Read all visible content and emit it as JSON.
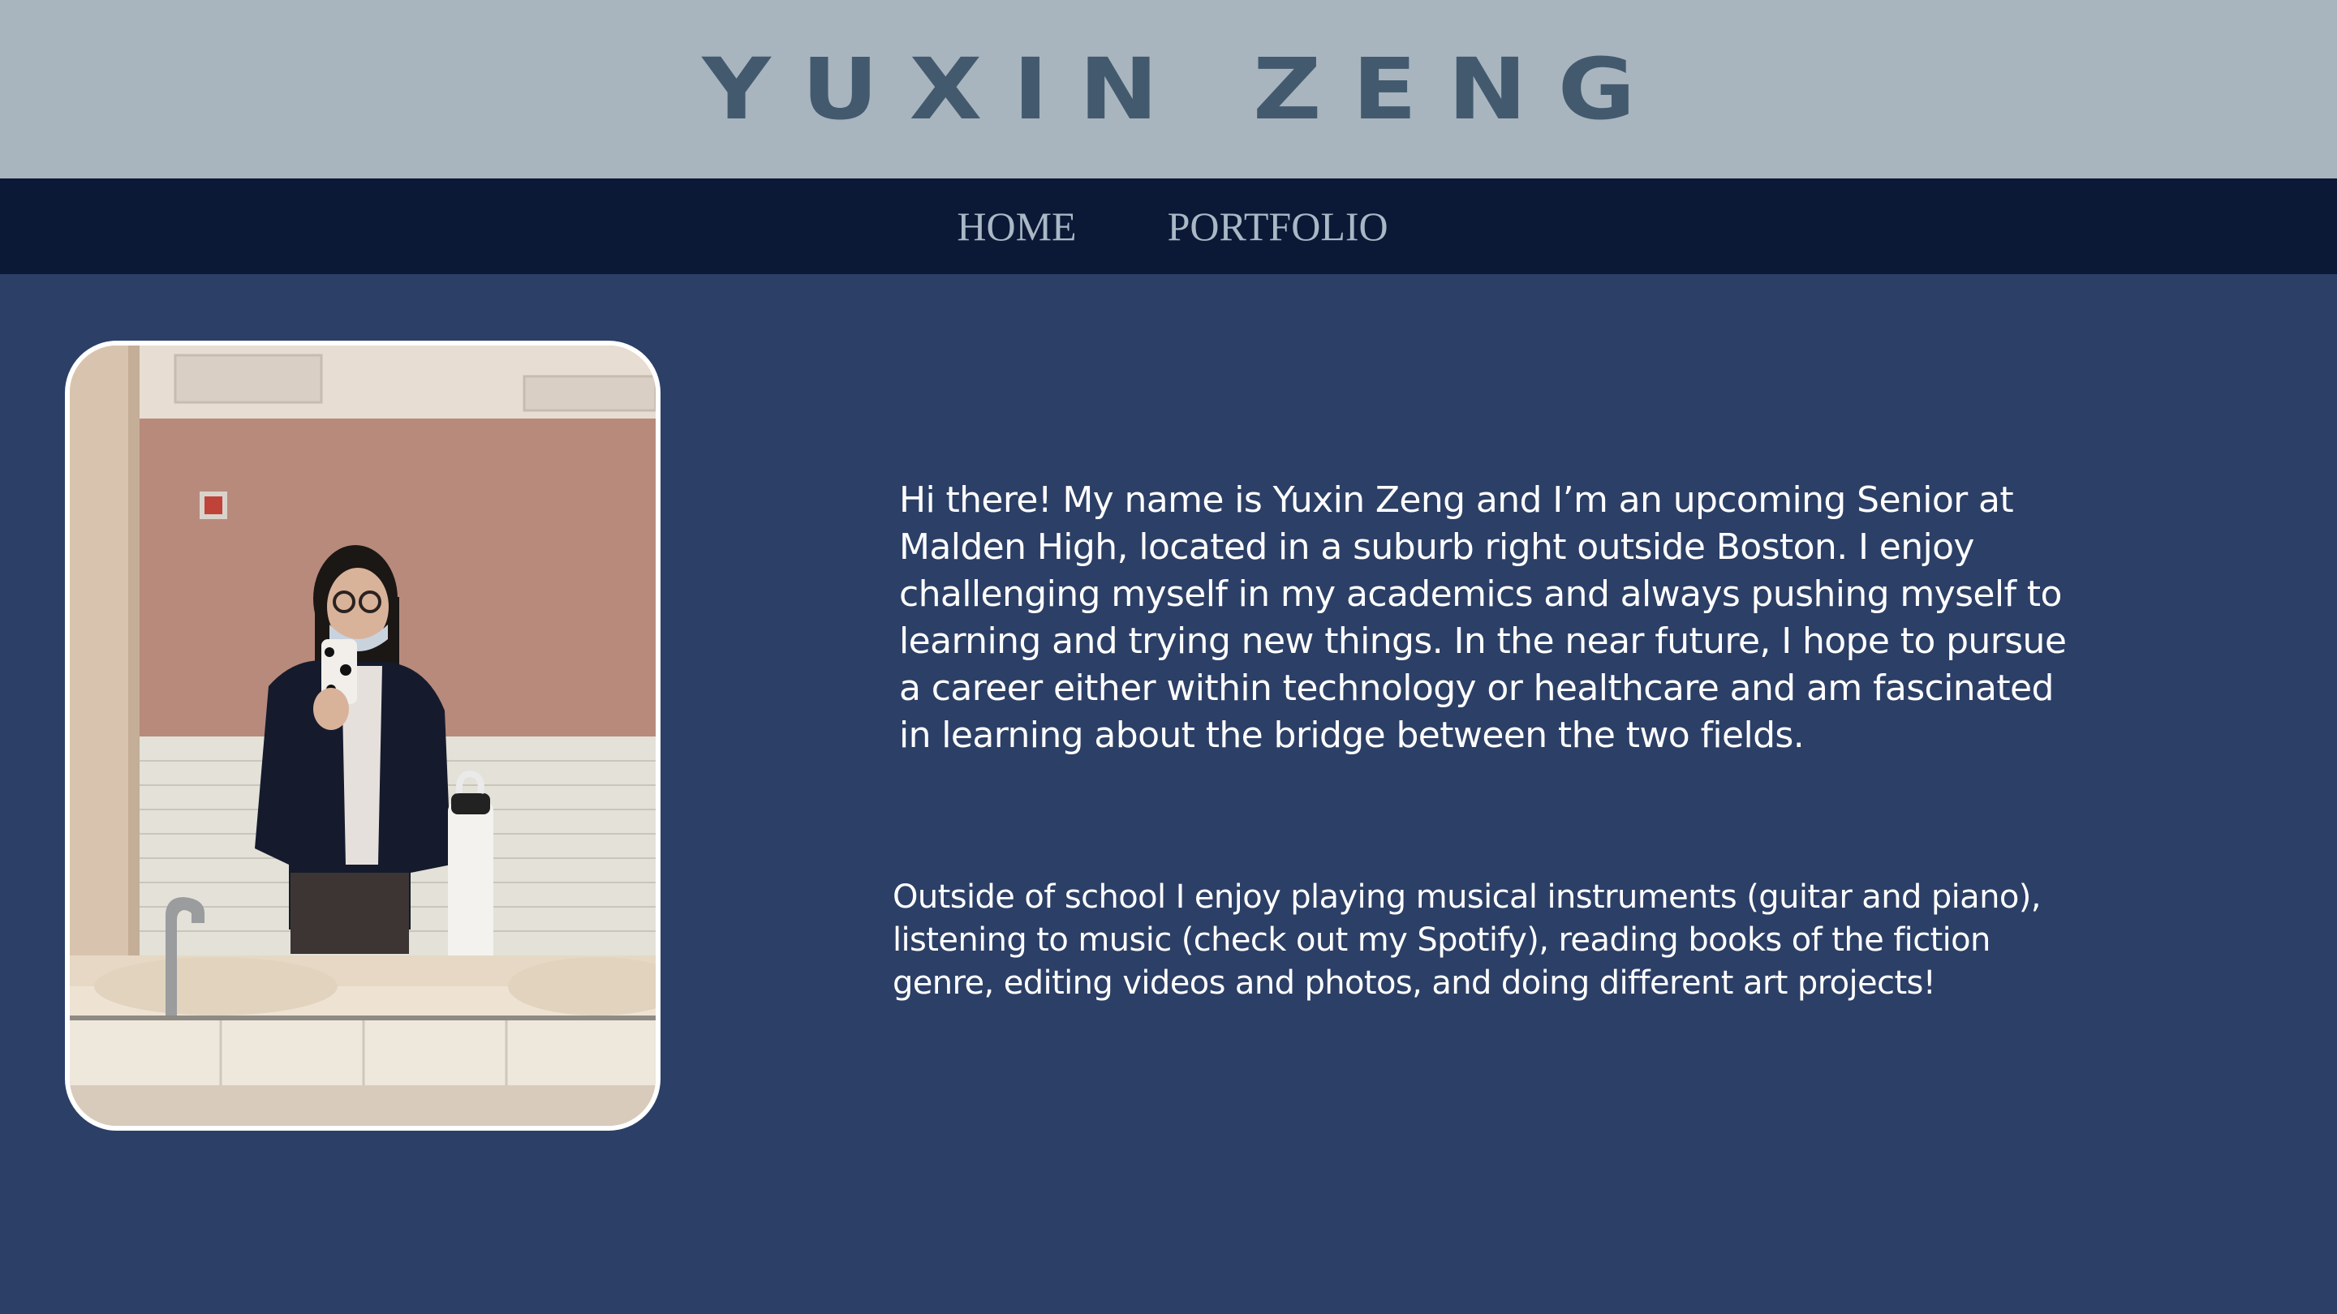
{
  "header": {
    "title": "YUXIN ZENG"
  },
  "nav": {
    "items": [
      {
        "label": "HOME"
      },
      {
        "label": "PORTFOLIO"
      }
    ]
  },
  "profile": {
    "photo_alt": "Mirror selfie of Yuxin Zeng in a bathroom"
  },
  "bio": {
    "intro": "Hi there! My name is Yuxin Zeng and I’m an upcoming Senior at Malden High, located in a suburb right outside Boston. I enjoy challenging myself in my academics and always pushing myself to learning and trying new things. In the near future, I hope to pursue a career either within technology or healthcare and am fascinated in learning about the bridge between the two fields.",
    "hobbies": "Outside of school I enjoy playing musical instruments (guitar and piano), listening to music (check out my Spotify), reading books of the fiction genre, editing videos and photos, and doing different art projects!"
  },
  "colors": {
    "header_bg": "#a8b5bf",
    "title": "#435a6e",
    "nav_bg": "#0b1937",
    "nav_text": "#aab8c6",
    "page_bg": "#2c3f66",
    "body_text": "#ffffff"
  }
}
